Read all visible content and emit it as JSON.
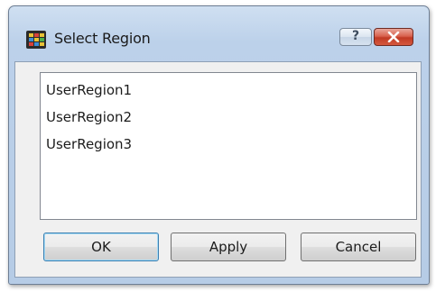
{
  "window": {
    "title": "Select Region",
    "app_icon": "region-grid-icon",
    "help_label": "?",
    "close_icon": "close-icon"
  },
  "regions": {
    "items": [
      "UserRegion1",
      "UserRegion2",
      "UserRegion3"
    ]
  },
  "buttons": {
    "ok_label": "OK",
    "apply_label": "Apply",
    "cancel_label": "Cancel"
  },
  "colors": {
    "titlebar": "#bcd1ea",
    "close": "#c13a24",
    "default_button_border": "#3c7fb1"
  }
}
